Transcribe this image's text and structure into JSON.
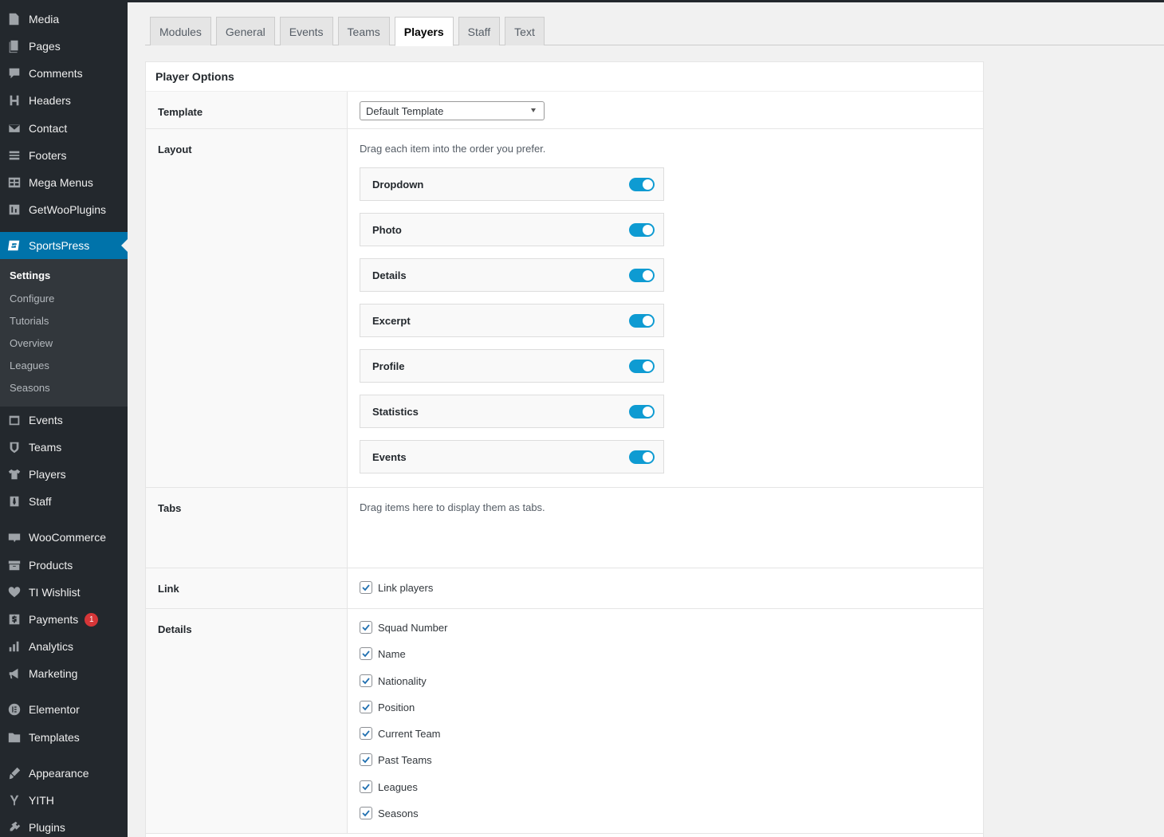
{
  "sidebar": {
    "items": [
      {
        "label": "Media",
        "icon": "media-icon"
      },
      {
        "label": "Pages",
        "icon": "pages-icon"
      },
      {
        "label": "Comments",
        "icon": "comments-icon"
      },
      {
        "label": "Headers",
        "icon": "headers-icon"
      },
      {
        "label": "Contact",
        "icon": "mail-icon"
      },
      {
        "label": "Footers",
        "icon": "footers-icon"
      },
      {
        "label": "Mega Menus",
        "icon": "table-icon"
      },
      {
        "label": "GetWooPlugins",
        "icon": "plugin-grid-icon"
      },
      {
        "label": "SportsPress",
        "icon": "sportspress-icon"
      },
      {
        "label": "Events",
        "icon": "calendar-icon"
      },
      {
        "label": "Teams",
        "icon": "shield-icon"
      },
      {
        "label": "Players",
        "icon": "shirt-icon"
      },
      {
        "label": "Staff",
        "icon": "tie-icon"
      },
      {
        "label": "WooCommerce",
        "icon": "woo-icon"
      },
      {
        "label": "Products",
        "icon": "archive-icon"
      },
      {
        "label": "TI Wishlist",
        "icon": "heart-icon"
      },
      {
        "label": "Payments",
        "icon": "dollar-icon",
        "badge": "1"
      },
      {
        "label": "Analytics",
        "icon": "bar-chart-icon"
      },
      {
        "label": "Marketing",
        "icon": "megaphone-icon"
      },
      {
        "label": "Elementor",
        "icon": "elementor-icon"
      },
      {
        "label": "Templates",
        "icon": "folder-icon"
      },
      {
        "label": "Appearance",
        "icon": "brush-icon"
      },
      {
        "label": "YITH",
        "icon": "yith-icon"
      },
      {
        "label": "Plugins",
        "icon": "plug-icon"
      }
    ],
    "submenu": [
      "Settings",
      "Configure",
      "Tutorials",
      "Overview",
      "Leagues",
      "Seasons"
    ]
  },
  "tabs": [
    "Modules",
    "General",
    "Events",
    "Teams",
    "Players",
    "Staff",
    "Text"
  ],
  "active_tab": "Players",
  "panel": {
    "title": "Player Options",
    "template": {
      "label": "Template",
      "value": "Default Template"
    },
    "layout": {
      "label": "Layout",
      "hint": "Drag each item into the order you prefer.",
      "items": [
        "Dropdown",
        "Photo",
        "Details",
        "Excerpt",
        "Profile",
        "Statistics",
        "Events"
      ]
    },
    "tabs_row": {
      "label": "Tabs",
      "hint": "Drag items here to display them as tabs."
    },
    "link": {
      "label": "Link",
      "option": "Link players"
    },
    "details": {
      "label": "Details",
      "options": [
        "Squad Number",
        "Name",
        "Nationality",
        "Position",
        "Current Team",
        "Past Teams",
        "Leagues",
        "Seasons"
      ]
    }
  },
  "colors": {
    "accent": "#0073aa",
    "toggle": "#0e9bd2",
    "sidebar": "#23282d"
  }
}
